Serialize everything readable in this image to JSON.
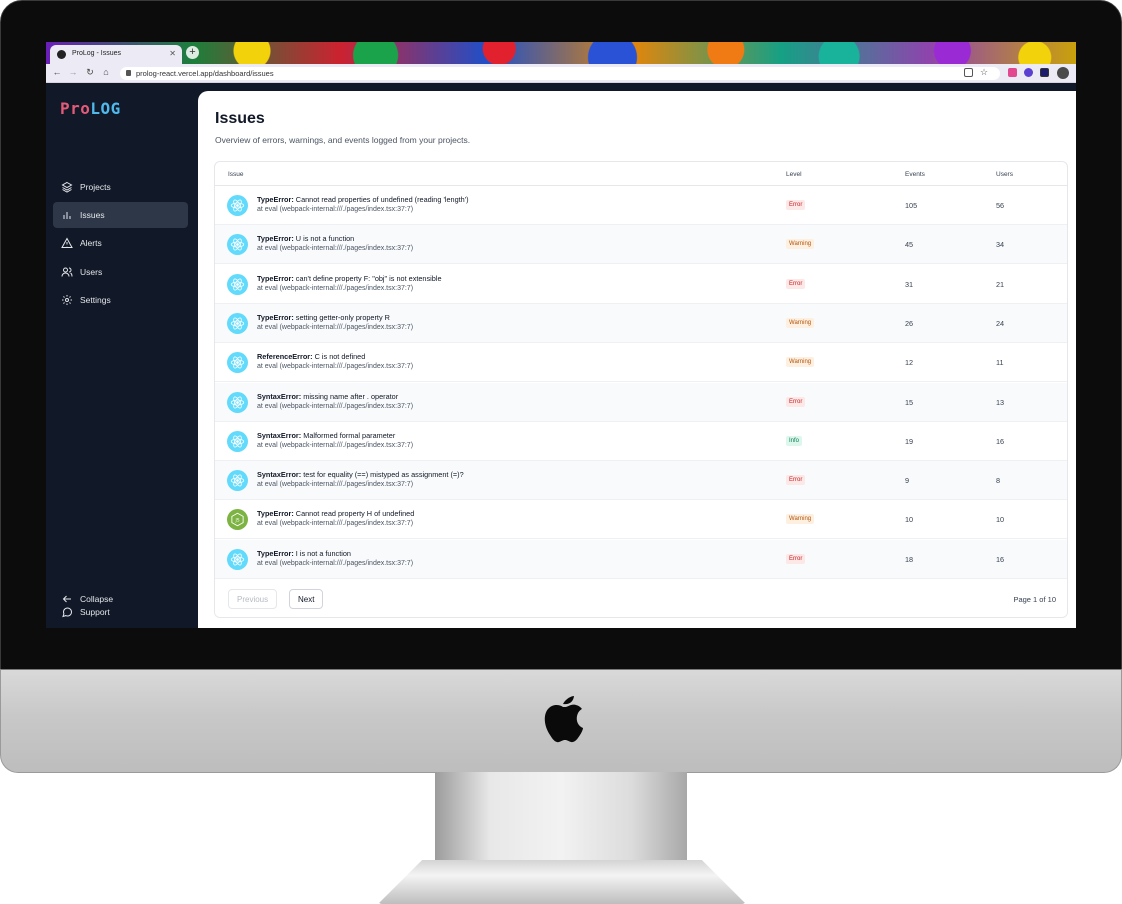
{
  "browser": {
    "tab_title": "ProLog - Issues",
    "url": "prolog-react.vercel.app/dashboard/issues"
  },
  "app": {
    "logo": {
      "part1": "Pro",
      "part2": "LOG"
    },
    "nav": [
      {
        "label": "Projects",
        "icon": "layers-icon",
        "active": false
      },
      {
        "label": "Issues",
        "icon": "bar-chart-icon",
        "active": true
      },
      {
        "label": "Alerts",
        "icon": "alert-icon",
        "active": false
      },
      {
        "label": "Users",
        "icon": "users-icon",
        "active": false
      },
      {
        "label": "Settings",
        "icon": "gear-icon",
        "active": false
      }
    ],
    "footer_nav": [
      {
        "label": "Support",
        "icon": "chat-icon"
      },
      {
        "label": "Collapse",
        "icon": "arrow-left-icon"
      }
    ]
  },
  "page": {
    "title": "Issues",
    "subtitle": "Overview of errors, warnings, and events logged from your projects."
  },
  "table": {
    "headers": {
      "issue": "Issue",
      "level": "Level",
      "events": "Events",
      "users": "Users"
    },
    "rows": [
      {
        "type": "TypeError:",
        "message": "Cannot read properties of undefined (reading 'length')",
        "location": "at eval (webpack-internal:///./pages/index.tsx:37:7)",
        "level": "Error",
        "events": "105",
        "users": "56",
        "platform": "react"
      },
      {
        "type": "TypeError:",
        "message": "U is not a function",
        "location": "at eval (webpack-internal:///./pages/index.tsx:37:7)",
        "level": "Warning",
        "events": "45",
        "users": "34",
        "platform": "react"
      },
      {
        "type": "TypeError:",
        "message": "can't define property F: \"obj\" is not extensible",
        "location": "at eval (webpack-internal:///./pages/index.tsx:37:7)",
        "level": "Error",
        "events": "31",
        "users": "21",
        "platform": "react"
      },
      {
        "type": "TypeError:",
        "message": "setting getter-only property R",
        "location": "at eval (webpack-internal:///./pages/index.tsx:37:7)",
        "level": "Warning",
        "events": "26",
        "users": "24",
        "platform": "react"
      },
      {
        "type": "ReferenceError:",
        "message": "C is not defined",
        "location": "at eval (webpack-internal:///./pages/index.tsx:37:7)",
        "level": "Warning",
        "events": "12",
        "users": "11",
        "platform": "react"
      },
      {
        "type": "SyntaxError:",
        "message": "missing name after . operator",
        "location": "at eval (webpack-internal:///./pages/index.tsx:37:7)",
        "level": "Error",
        "events": "15",
        "users": "13",
        "platform": "react"
      },
      {
        "type": "SyntaxError:",
        "message": "Malformed formal parameter",
        "location": "at eval (webpack-internal:///./pages/index.tsx:37:7)",
        "level": "Info",
        "events": "19",
        "users": "16",
        "platform": "react"
      },
      {
        "type": "SyntaxError:",
        "message": "test for equality (==) mistyped as assignment (=)?",
        "location": "at eval (webpack-internal:///./pages/index.tsx:37:7)",
        "level": "Error",
        "events": "9",
        "users": "8",
        "platform": "react"
      },
      {
        "type": "TypeError:",
        "message": "Cannot read property H of undefined",
        "location": "at eval (webpack-internal:///./pages/index.tsx:37:7)",
        "level": "Warning",
        "events": "10",
        "users": "10",
        "platform": "node"
      },
      {
        "type": "TypeError:",
        "message": "I is not a function",
        "location": "at eval (webpack-internal:///./pages/index.tsx:37:7)",
        "level": "Error",
        "events": "18",
        "users": "16",
        "platform": "react"
      }
    ]
  },
  "pagination": {
    "previous": "Previous",
    "next": "Next",
    "info": "Page 1 of 10"
  },
  "colors": {
    "sidebar_bg": "#111827",
    "error": "#c81e1e",
    "warning": "#b45309",
    "info": "#057a55",
    "react": "#61dafb",
    "node": "#7cb342"
  }
}
